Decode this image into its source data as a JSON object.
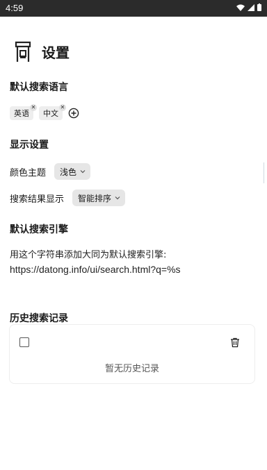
{
  "status_bar": {
    "time": "4:59"
  },
  "header": {
    "title": "设置"
  },
  "language_section": {
    "title": "默认搜索语言",
    "tags": [
      {
        "label": "英语"
      },
      {
        "label": "中文"
      }
    ]
  },
  "display_section": {
    "title": "显示设置",
    "theme": {
      "label": "颜色主题",
      "value": "浅色"
    },
    "result_display": {
      "label": "搜索结果显示",
      "value": "智能排序"
    }
  },
  "engine_section": {
    "title": "默认搜索引擎",
    "description": "用这个字符串添加大同为默认搜索引擎:",
    "url": "https://datong.info/ui/search.html?q=%s"
  },
  "history_section": {
    "title": "历史搜索记录",
    "empty_text": "暂无历史记录"
  }
}
